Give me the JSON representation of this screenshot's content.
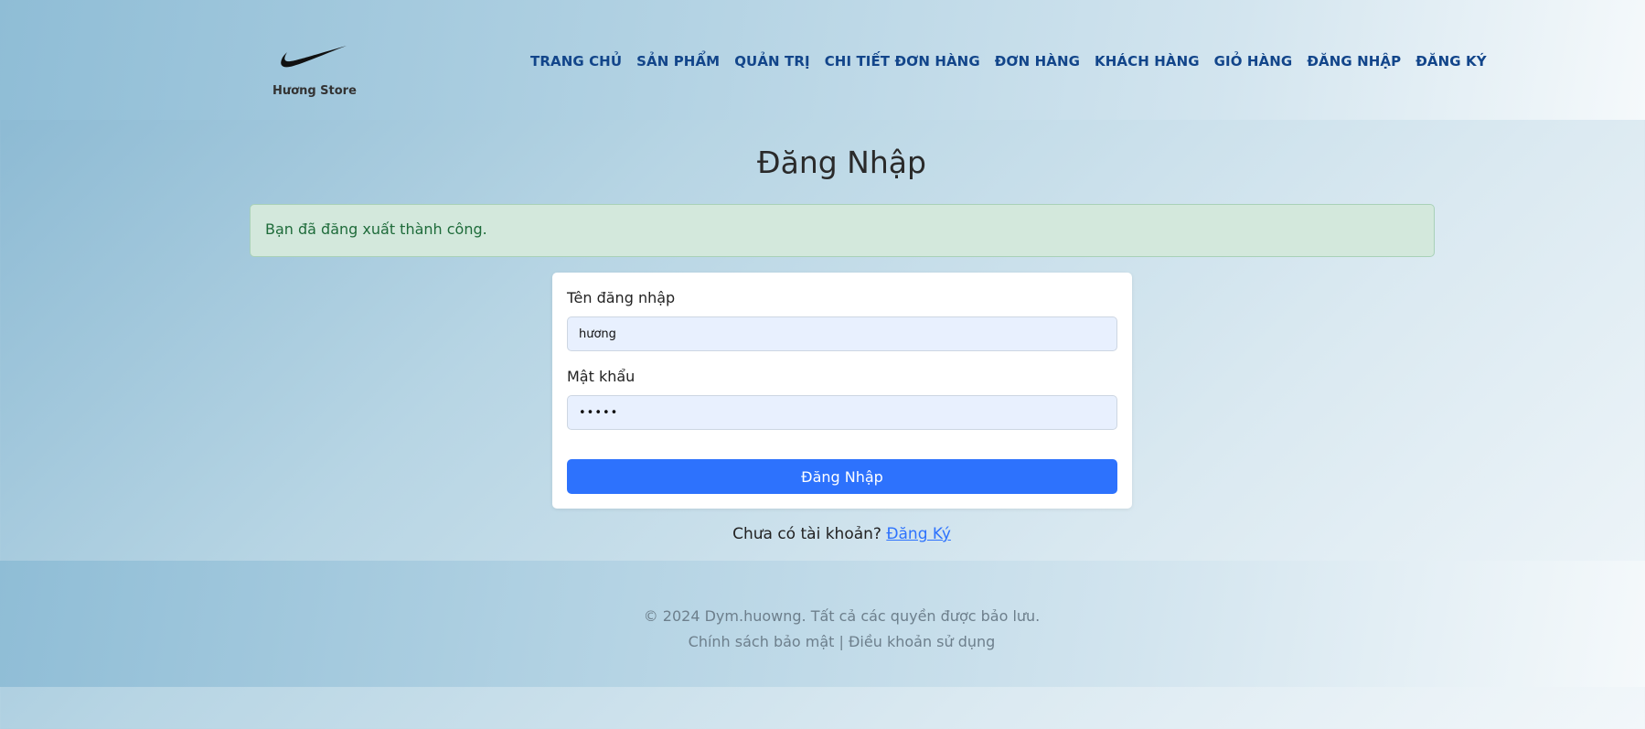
{
  "brand": {
    "name": "Hương Store",
    "logo_icon": "swoosh-icon"
  },
  "nav": {
    "items": [
      "TRANG CHỦ",
      "SẢN PHẨM",
      "QUẢN TRỊ",
      "CHI TIẾT ĐƠN HÀNG",
      "ĐƠN HÀNG",
      "KHÁCH HÀNG",
      "GIỎ HÀNG",
      "ĐĂNG NHẬP",
      "ĐĂNG KÝ"
    ]
  },
  "page": {
    "title": "Đăng Nhập"
  },
  "alert": {
    "message": "Bạn đã đăng xuất thành công."
  },
  "form": {
    "username_label": "Tên đăng nhập",
    "username_value": "hương",
    "password_label": "Mật khẩu",
    "password_value": "•••••",
    "submit_label": "Đăng Nhập"
  },
  "register": {
    "prompt": "Chưa có tài khoản?",
    "link_label": "Đăng Ký"
  },
  "footer": {
    "copyright": "© 2024 Dym.huowng. Tất cả các quyền được bảo lưu.",
    "privacy": "Chính sách bảo mật",
    "separator": "|",
    "terms": "Điều khoản sử dụng"
  },
  "colors": {
    "nav_text": "#12458a",
    "primary": "#2d72fd",
    "alert_bg": "#d3e8dc",
    "alert_text": "#1e6b3a",
    "input_bg": "#e8f0fe"
  }
}
